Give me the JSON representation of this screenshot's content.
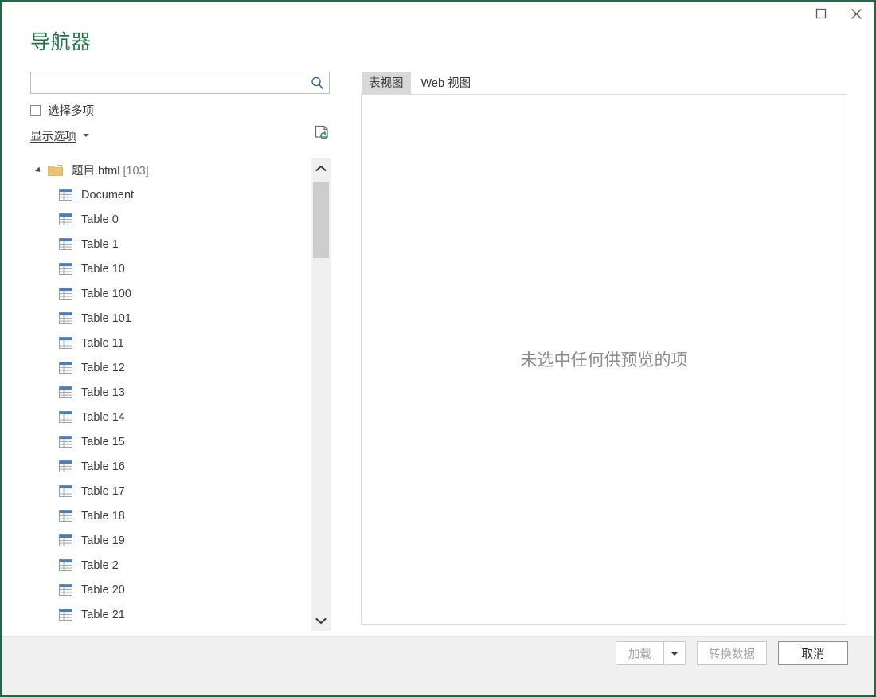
{
  "window": {
    "accent_color": "#217346",
    "border_color": "#1e6b43",
    "title": "导航器"
  },
  "titlebar": {
    "maximize_icon": "maximize-icon",
    "close_icon": "close-icon"
  },
  "left_pane": {
    "search": {
      "value": "",
      "placeholder": "",
      "icon": "search-icon"
    },
    "multi_select": {
      "label": "选择多项",
      "checked": false
    },
    "display_options": {
      "label": "显示选项",
      "caret_icon": "chevron-down-icon"
    },
    "refresh": {
      "icon": "refresh-document-icon"
    },
    "tree": {
      "root": {
        "name": "题目.html",
        "count": "[103]",
        "expanded": true,
        "icon": "folder-icon"
      },
      "children": [
        {
          "label": "Document",
          "icon": "table-icon"
        },
        {
          "label": "Table 0",
          "icon": "table-icon"
        },
        {
          "label": "Table 1",
          "icon": "table-icon"
        },
        {
          "label": "Table 10",
          "icon": "table-icon"
        },
        {
          "label": "Table 100",
          "icon": "table-icon"
        },
        {
          "label": "Table 101",
          "icon": "table-icon"
        },
        {
          "label": "Table 11",
          "icon": "table-icon"
        },
        {
          "label": "Table 12",
          "icon": "table-icon"
        },
        {
          "label": "Table 13",
          "icon": "table-icon"
        },
        {
          "label": "Table 14",
          "icon": "table-icon"
        },
        {
          "label": "Table 15",
          "icon": "table-icon"
        },
        {
          "label": "Table 16",
          "icon": "table-icon"
        },
        {
          "label": "Table 17",
          "icon": "table-icon"
        },
        {
          "label": "Table 18",
          "icon": "table-icon"
        },
        {
          "label": "Table 19",
          "icon": "table-icon"
        },
        {
          "label": "Table 2",
          "icon": "table-icon"
        },
        {
          "label": "Table 20",
          "icon": "table-icon"
        },
        {
          "label": "Table 21",
          "icon": "table-icon"
        }
      ]
    },
    "scrollbar": {
      "up_icon": "chevron-up-icon",
      "down_icon": "chevron-down-icon"
    }
  },
  "right_pane": {
    "tabs": [
      {
        "label": "表视图",
        "active": true
      },
      {
        "label": "Web 视图",
        "active": false
      }
    ],
    "preview_empty_message": "未选中任何供预览的项"
  },
  "footer": {
    "load_button": {
      "label": "加载",
      "enabled": false
    },
    "load_dropdown": {
      "icon": "chevron-down-icon"
    },
    "transform_button": {
      "label": "转换数据",
      "enabled": false
    },
    "cancel_button": {
      "label": "取消",
      "enabled": true
    }
  }
}
